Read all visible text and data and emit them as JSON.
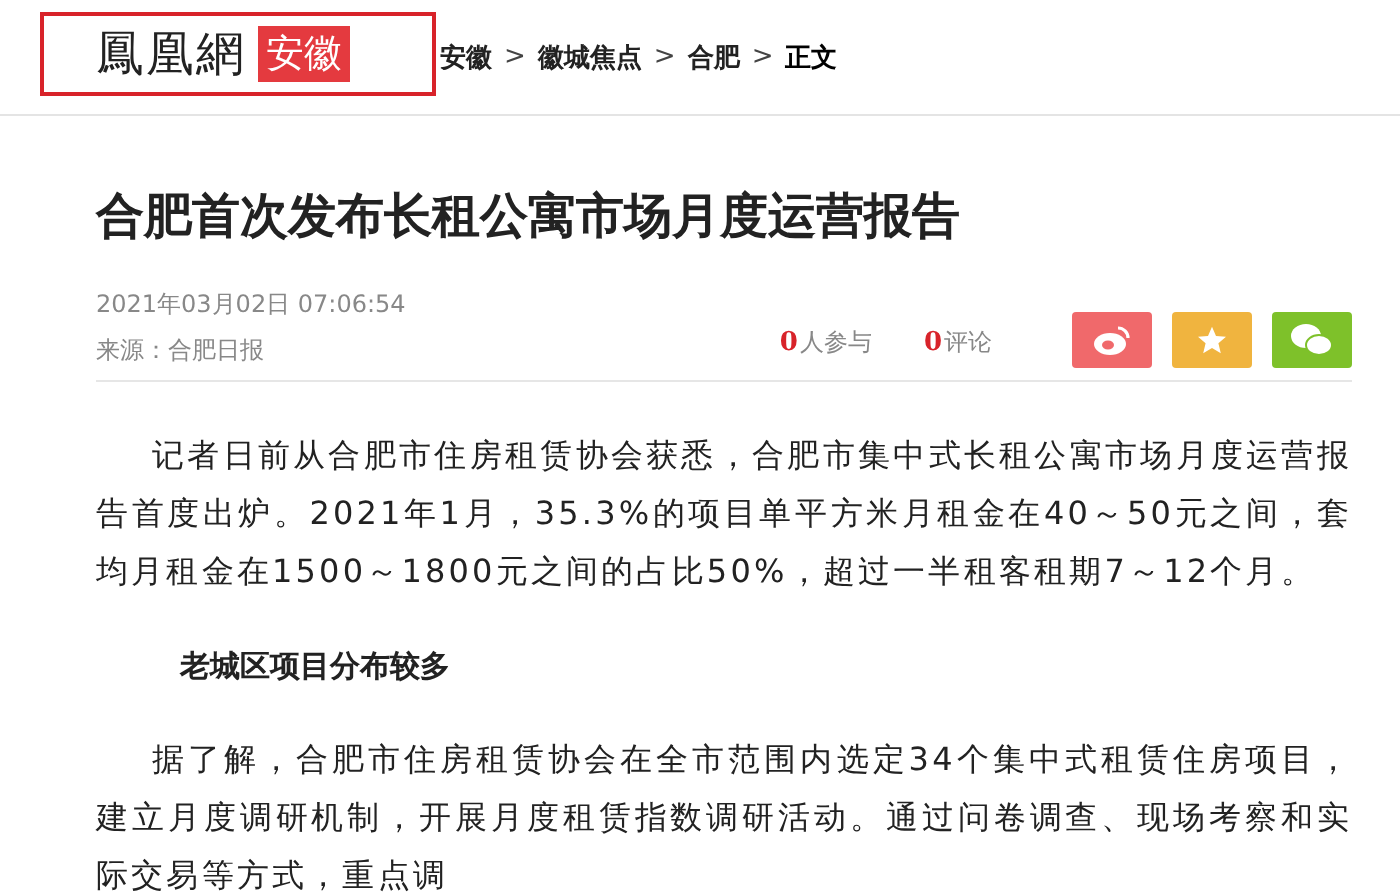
{
  "header": {
    "logo": {
      "name": "鳳凰網",
      "region": "安徽"
    },
    "breadcrumb": [
      {
        "kind": "link",
        "text": "安徽"
      },
      {
        "kind": "separator",
        "text": ">"
      },
      {
        "kind": "link",
        "text": "徽城焦点"
      },
      {
        "kind": "separator",
        "text": ">"
      },
      {
        "kind": "link",
        "text": "合肥"
      },
      {
        "kind": "separator",
        "text": ">"
      },
      {
        "kind": "current",
        "text": "正文"
      }
    ]
  },
  "article": {
    "title": "合肥首次发布长租公寓市场月度运营报告",
    "date": "2021年03月02日 07:06:54",
    "source": "来源：合肥日报",
    "stats": [
      {
        "count": "0",
        "label": "人参与"
      },
      {
        "count": "0",
        "label": "评论"
      }
    ],
    "share": [
      {
        "kind": "weibo",
        "color": "#f0696b"
      },
      {
        "kind": "favorite",
        "color": "#f0b43f"
      },
      {
        "kind": "wechat",
        "color": "#7ec12a"
      }
    ],
    "body": [
      {
        "kind": "paragraph",
        "text": "记者日前从合肥市住房租赁协会获悉，合肥市集中式长租公寓市场月度运营报告首度出炉。2021年1月，35.3%的项目单平方米月租金在40～50元之间，套均月租金在1500～1800元之间的占比50%，超过一半租客租期7～12个月。"
      },
      {
        "kind": "heading",
        "text": "老城区项目分布较多"
      },
      {
        "kind": "paragraph",
        "text": "据了解，合肥市住房租赁协会在全市范围内选定34个集中式租赁住房项目，建立月度调研机制，开展月度租赁指数调研活动。通过问卷调查、现场考察和实际交易等方式，重点调"
      }
    ]
  }
}
